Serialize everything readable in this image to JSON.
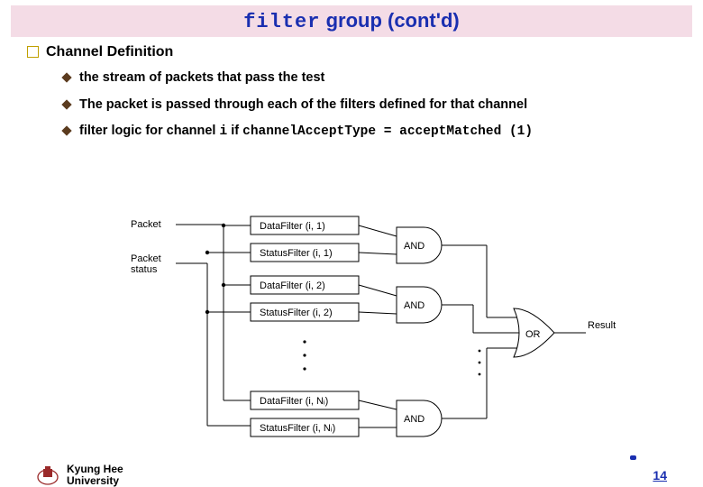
{
  "title": {
    "mono": "filter",
    "rest": " group (cont'd)"
  },
  "section": {
    "heading": "Channel Definition",
    "bullets": [
      {
        "text": "the stream of packets that pass the test"
      },
      {
        "text": "The packet is passed through each of the filters defined for that channel"
      },
      {
        "prefix": "filter logic for channel ",
        "code1": "i",
        "mid": " if ",
        "code2": "channelAcceptType = acceptMatched (1)"
      }
    ]
  },
  "diagram": {
    "input_packet": "Packet",
    "input_status": "Packet status",
    "boxes": [
      "DataFilter (i, 1)",
      "StatusFilter (i, 1)",
      "DataFilter (i, 2)",
      "StatusFilter (i, 2)",
      "DataFilter (i, Nᵢ)",
      "StatusFilter (i, Nᵢ)"
    ],
    "and_label": "AND",
    "or_label": "OR",
    "result_label": "Result"
  },
  "footer": {
    "university_line1": "Kyung Hee",
    "university_line2": "University",
    "page": "14"
  }
}
